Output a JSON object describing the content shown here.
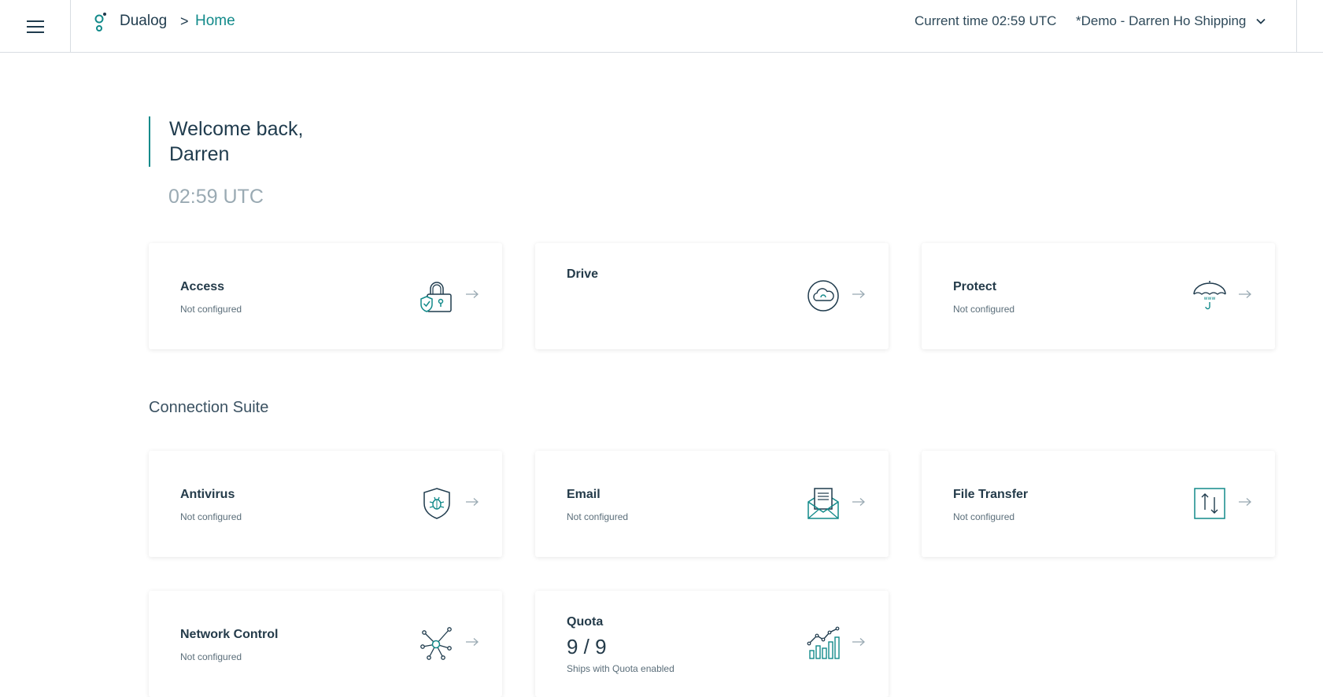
{
  "header": {
    "brand": "Dualog",
    "breadcrumb_separator": ">",
    "current_page": "Home",
    "current_time": "Current time 02:59 UTC",
    "account": "*Demo - Darren Ho Shipping"
  },
  "welcome": {
    "line1": "Welcome back,",
    "line2": "Darren",
    "time": "02:59 UTC"
  },
  "cards_top": [
    {
      "title": "Access",
      "status": "Not configured",
      "icon": "lock-shield-icon"
    },
    {
      "title": "Drive",
      "status": "",
      "icon": "cloud-icon"
    },
    {
      "title": "Protect",
      "status": "Not configured",
      "icon": "umbrella-www-icon"
    }
  ],
  "section": {
    "title": "Connection Suite"
  },
  "cards_suite": [
    {
      "title": "Antivirus",
      "status": "Not configured",
      "icon": "shield-bug-icon"
    },
    {
      "title": "Email",
      "status": "Not configured",
      "icon": "envelope-letter-icon"
    },
    {
      "title": "File Transfer",
      "status": "Not configured",
      "icon": "upload-download-icon"
    },
    {
      "title": "Network Control",
      "status": "Not configured",
      "icon": "network-nodes-icon"
    },
    {
      "title": "Quota",
      "value": "9 / 9",
      "status": "Ships with Quota enabled",
      "icon": "bar-chart-trend-icon"
    }
  ],
  "colors": {
    "accent": "#128a8a",
    "text": "#1f3b4d",
    "muted": "#9aaab3"
  }
}
